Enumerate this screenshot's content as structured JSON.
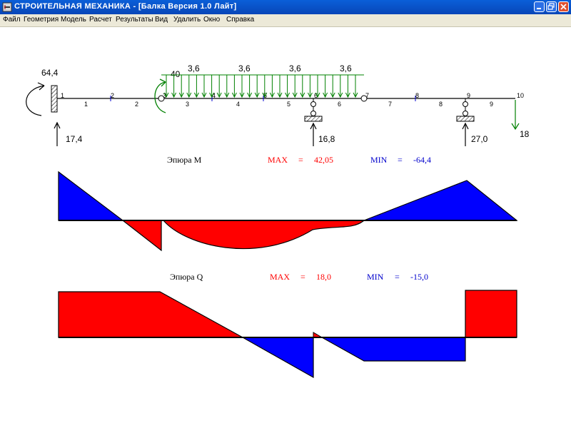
{
  "window": {
    "title": "СТРОИТЕЛЬНАЯ   МЕХАНИКА - [Балка  Версия 1.0 Лайт]"
  },
  "menu": {
    "items": [
      "Файл",
      "Геометрия",
      "Модель",
      "Расчет",
      "Результаты",
      "Вид",
      "Удалить",
      "Окно",
      "Справка"
    ]
  },
  "beam": {
    "node_labels": [
      "1",
      "2",
      "3",
      "4",
      "5",
      "6",
      "7",
      "8",
      "9",
      "10"
    ],
    "element_labels": [
      "1",
      "2",
      "3",
      "4",
      "5",
      "6",
      "7",
      "8",
      "9"
    ],
    "moment_load": "64,4",
    "reaction_left": "17,4",
    "reaction_mid": "16,8",
    "reaction_right": "27,0",
    "point_load_end": "18",
    "applied_moment": "40",
    "distributed_load_labels": [
      "3,6",
      "3,6",
      "3,6",
      "3,6"
    ]
  },
  "diagram_m": {
    "title": "Эпюра M",
    "max_label": "MAX",
    "eq1": "=",
    "max_value": "42,05",
    "min_label": "MIN",
    "eq2": "=",
    "min_value": "-64,4"
  },
  "diagram_q": {
    "title": "Эпюра Q",
    "max_label": "MAX",
    "eq1": "=",
    "max_value": "18,0",
    "min_label": "MIN",
    "eq2": "=",
    "min_value": "-15,0"
  },
  "colors": {
    "positive": "#0000ff",
    "negative": "#ff0000",
    "load": "#008000",
    "beam": "#000000"
  }
}
